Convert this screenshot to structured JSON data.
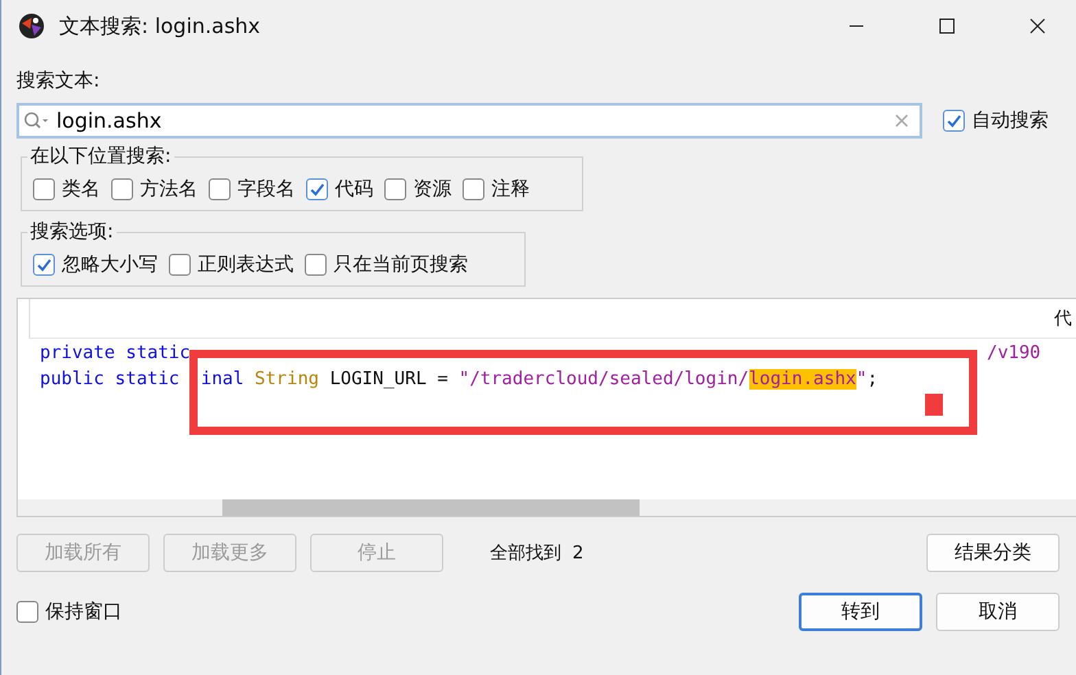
{
  "window": {
    "title": "文本搜索: login.ashx"
  },
  "search_label": "搜索文本:",
  "search": {
    "value": "login.ashx"
  },
  "auto_search": {
    "label": "自动搜索",
    "checked": true
  },
  "search_in": {
    "title": "在以下位置搜索:",
    "options": [
      {
        "label": "类名",
        "checked": false
      },
      {
        "label": "方法名",
        "checked": false
      },
      {
        "label": "字段名",
        "checked": false
      },
      {
        "label": "代码",
        "checked": true
      },
      {
        "label": "资源",
        "checked": false
      },
      {
        "label": "注释",
        "checked": false
      }
    ]
  },
  "search_options": {
    "title": "搜索选项:",
    "options": [
      {
        "label": "忽略大小写",
        "checked": true
      },
      {
        "label": "正则表达式",
        "checked": false
      },
      {
        "label": "只在当前页搜索",
        "checked": false
      }
    ]
  },
  "results": {
    "column_2": "代",
    "lines": [
      [
        {
          "kind": "keyword",
          "text": "private static"
        },
        {
          "kind": "string",
          "text": "/v190",
          "after_cover": true
        }
      ],
      [
        {
          "kind": "keyword",
          "text": "public static "
        },
        {
          "kind": "keyword",
          "text": "inal ",
          "gap_before": true
        },
        {
          "kind": "type",
          "text": "String "
        },
        {
          "kind": "plain",
          "text": "LOGIN_URL = "
        },
        {
          "kind": "string",
          "text": "\"/tradercloud/sealed/login/"
        },
        {
          "kind": "highlight",
          "text": "login.ashx"
        },
        {
          "kind": "string",
          "text": "\""
        },
        {
          "kind": "plain",
          "text": ";"
        }
      ]
    ]
  },
  "buttons": [
    {
      "label": "加载所有",
      "disabled": true
    },
    {
      "label": "加载更多",
      "disabled": true
    },
    {
      "label": "停止",
      "disabled": true
    }
  ],
  "found": {
    "label": "全部找到",
    "count": "2"
  },
  "group_button": "结果分类",
  "keep_window": {
    "label": "保持窗口",
    "checked": false
  },
  "dialog_buttons": [
    {
      "label": "转到",
      "selected": true
    },
    {
      "label": "取消",
      "selected": false
    }
  ]
}
